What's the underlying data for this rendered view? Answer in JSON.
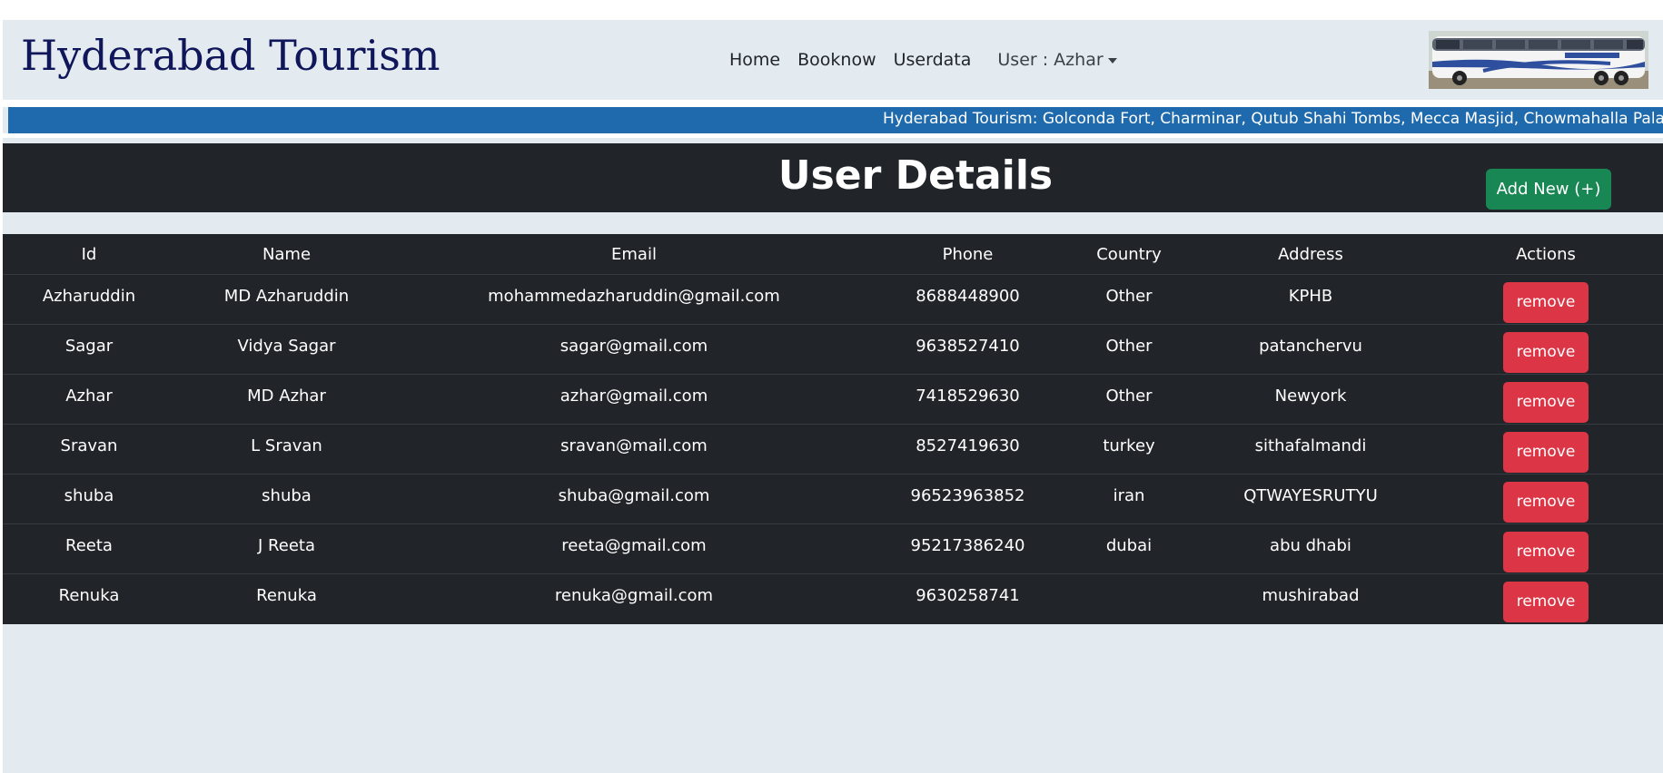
{
  "brand": "Hyderabad Tourism",
  "nav": {
    "links": [
      "Home",
      "Booknow",
      "Userdata"
    ],
    "user_label": "User : Azhar"
  },
  "ticker": "Hyderabad Tourism: Golconda Fort, Charminar, Qutub Shahi Tombs, Mecca Masjid, Chowmahalla Palac",
  "page_title": "User Details",
  "add_button": "Add New (+)",
  "table": {
    "headers": [
      "Id",
      "Name",
      "Email",
      "Phone",
      "Country",
      "Address",
      "Actions"
    ],
    "action_label": "remove",
    "rows": [
      {
        "id": "Azharuddin",
        "name": "MD Azharuddin",
        "email": "mohammedazharuddin@gmail.com",
        "phone": "8688448900",
        "country": "Other",
        "address": "KPHB"
      },
      {
        "id": "Sagar",
        "name": "Vidya Sagar",
        "email": "sagar@gmail.com",
        "phone": "9638527410",
        "country": "Other",
        "address": "patanchervu"
      },
      {
        "id": "Azhar",
        "name": "MD Azhar",
        "email": "azhar@gmail.com",
        "phone": "7418529630",
        "country": "Other",
        "address": "Newyork"
      },
      {
        "id": "Sravan",
        "name": "L Sravan",
        "email": "sravan@mail.com",
        "phone": "8527419630",
        "country": "turkey",
        "address": "sithafalmandi"
      },
      {
        "id": "shuba",
        "name": "shuba",
        "email": "shuba@gmail.com",
        "phone": "96523963852",
        "country": "iran",
        "address": "QTWAYESRUTYU"
      },
      {
        "id": "Reeta",
        "name": "J Reeta",
        "email": "reeta@gmail.com",
        "phone": "95217386240",
        "country": "dubai",
        "address": "abu dhabi"
      },
      {
        "id": "Renuka",
        "name": "Renuka",
        "email": "renuka@gmail.com",
        "phone": "9630258741",
        "country": "",
        "address": "mushirabad"
      }
    ]
  },
  "colors": {
    "brand_text": "#10165a",
    "ticker_bg": "#1f6aad",
    "dark_bg": "#212529",
    "add_button_bg": "#198754",
    "remove_button_bg": "#dc3545",
    "page_bg": "#e3eaf0"
  },
  "icons": {
    "user_dropdown": "caret-down-icon",
    "bus_image": "bus-photo"
  }
}
